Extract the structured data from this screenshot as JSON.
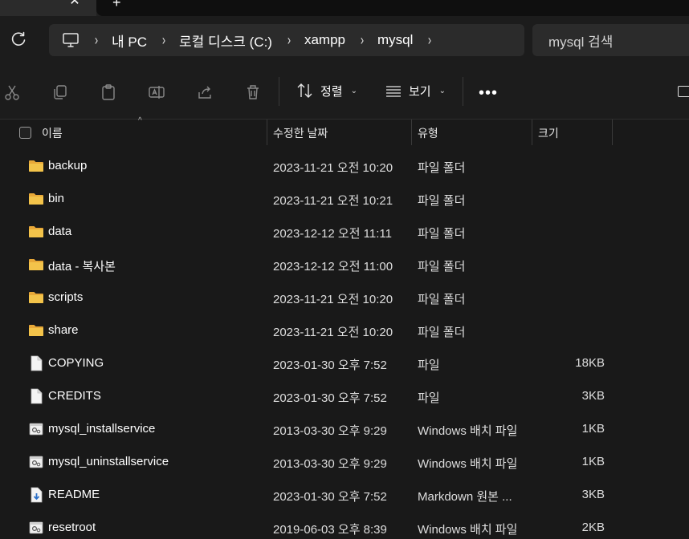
{
  "tabs": {
    "close_glyph": "✕",
    "new_glyph": "+"
  },
  "address": {
    "breadcrumb": [
      "내 PC",
      "로컬 디스크 (C:)",
      "xampp",
      "mysql"
    ],
    "separator": "›",
    "search_placeholder": "mysql 검색"
  },
  "toolbar": {
    "sort_label": "정렬",
    "view_label": "보기",
    "more_label": "•••",
    "chevron": "⌄"
  },
  "columns": {
    "name": "이름",
    "modified": "수정한 날짜",
    "type": "유형",
    "size": "크기"
  },
  "files": [
    {
      "name": "backup",
      "modified": "2023-11-21 오전 10:20",
      "type": "파일 폴더",
      "size": "",
      "icon": "folder-icon"
    },
    {
      "name": "bin",
      "modified": "2023-11-21 오전 10:21",
      "type": "파일 폴더",
      "size": "",
      "icon": "folder-icon"
    },
    {
      "name": "data",
      "modified": "2023-12-12 오전 11:11",
      "type": "파일 폴더",
      "size": "",
      "icon": "folder-icon"
    },
    {
      "name": "data - 복사본",
      "modified": "2023-12-12 오전 11:00",
      "type": "파일 폴더",
      "size": "",
      "icon": "folder-icon"
    },
    {
      "name": "scripts",
      "modified": "2023-11-21 오전 10:20",
      "type": "파일 폴더",
      "size": "",
      "icon": "folder-icon"
    },
    {
      "name": "share",
      "modified": "2023-11-21 오전 10:20",
      "type": "파일 폴더",
      "size": "",
      "icon": "folder-icon"
    },
    {
      "name": "COPYING",
      "modified": "2023-01-30 오후 7:52",
      "type": "파일",
      "size": "18KB",
      "icon": "file-icon"
    },
    {
      "name": "CREDITS",
      "modified": "2023-01-30 오후 7:52",
      "type": "파일",
      "size": "3KB",
      "icon": "file-icon"
    },
    {
      "name": "mysql_installservice",
      "modified": "2013-03-30 오후 9:29",
      "type": "Windows 배치 파일",
      "size": "1KB",
      "icon": "batch-file-icon"
    },
    {
      "name": "mysql_uninstallservice",
      "modified": "2013-03-30 오후 9:29",
      "type": "Windows 배치 파일",
      "size": "1KB",
      "icon": "batch-file-icon"
    },
    {
      "name": "README",
      "modified": "2023-01-30 오후 7:52",
      "type": "Markdown 원본 ...",
      "size": "3KB",
      "icon": "markdown-file-icon"
    },
    {
      "name": "resetroot",
      "modified": "2019-06-03 오후 8:39",
      "type": "Windows 배치 파일",
      "size": "2KB",
      "icon": "batch-file-icon"
    }
  ],
  "colors": {
    "folder": "#f3c34a",
    "background": "#191919",
    "panel": "#2b2b2b"
  }
}
